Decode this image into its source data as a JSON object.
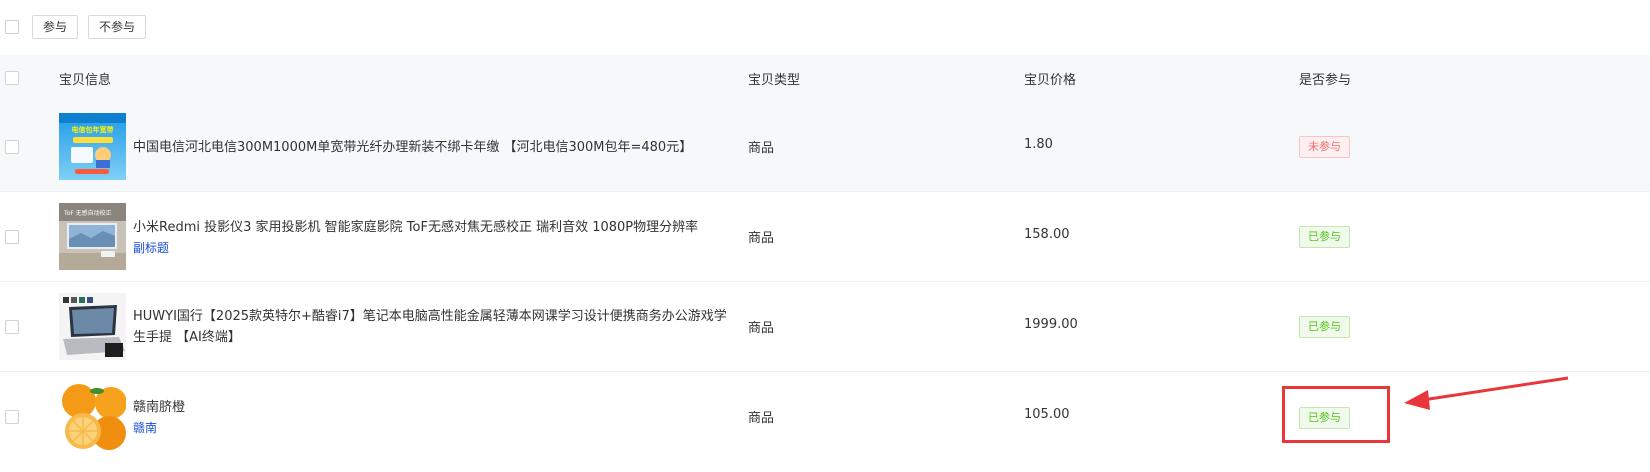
{
  "toolbar": {
    "join_label": "参与",
    "notjoin_label": "不参与"
  },
  "table": {
    "columns": [
      "宝贝信息",
      "宝贝类型",
      "宝贝价格",
      "是否参与"
    ],
    "rows": [
      {
        "title": "中国电信河北电信300M1000M单宽带光纤办理新装不绑卡年缴 【河北电信300M包年=480元】",
        "subtitle": "",
        "type": "商品",
        "price": "1.80",
        "status": "未参与",
        "thumb_icon": "broadband-promo-image",
        "thumb_text": "电信包年宽带"
      },
      {
        "title": "小米Redmi 投影仪3 家用投影机 智能家庭影院 ToF无感对焦无感校正 瑞利音效 1080P物理分辨率",
        "subtitle": "副标题",
        "type": "商品",
        "price": "158.00",
        "status": "已参与",
        "thumb_icon": "projector-image",
        "thumb_text": "ToF 无感自动校正"
      },
      {
        "title": "HUWYI国行【2025款英特尔+酷睿i7】笔记本电脑高性能金属轻薄本网课学习设计便携商务办公游戏学生手提 【AI终端】",
        "subtitle": "",
        "type": "商品",
        "price": "1999.00",
        "status": "已参与",
        "thumb_icon": "laptop-image",
        "thumb_text": ""
      },
      {
        "title": "赣南脐橙",
        "subtitle": "赣南",
        "type": "商品",
        "price": "105.00",
        "status": "已参与",
        "thumb_icon": "orange-image",
        "thumb_text": ""
      }
    ]
  },
  "colors": {
    "header_bg": "#f7f8fa",
    "status_no": "#f56c6c",
    "status_yes": "#52c41a",
    "annotation": "#e8363b",
    "link": "#1a4cd6"
  }
}
